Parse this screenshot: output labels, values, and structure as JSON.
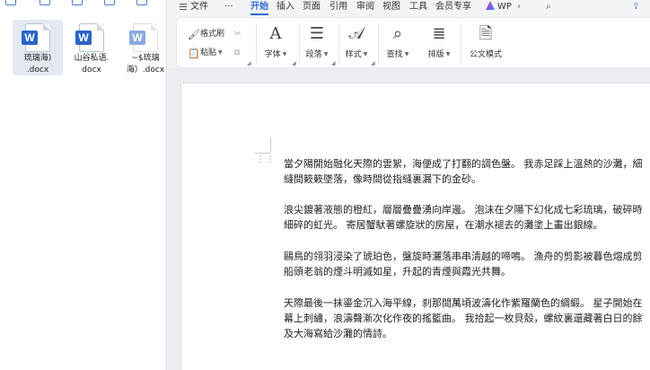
{
  "file_panel": {
    "files": [
      {
        "name_line1": "琉璃海)",
        "name_line2": ".docx"
      },
      {
        "name_line1": "山谷私语.",
        "name_line2": "docx"
      },
      {
        "name_line1": "~$琉璃",
        "name_line2": "海）.docx"
      }
    ]
  },
  "menubar": {
    "file_label": "文件",
    "more_label": "···",
    "tabs": [
      "开始",
      "插入",
      "页面",
      "引用",
      "审阅",
      "视图",
      "工具",
      "会员专享"
    ],
    "wps_label": "WP"
  },
  "ribbon": {
    "format_painter": "格式刷",
    "paste": "粘贴",
    "font": "字体",
    "paragraph": "段落",
    "style": "样式",
    "find": "查找",
    "layout": "排版",
    "official_mode": "公文模式"
  },
  "document": {
    "paragraphs": [
      {
        "line1": "當夕陽開始融化天際的雲絮，海便成了打翻的調色盤。  我赤足踩上溫熱的沙灘，細",
        "line2": "縫間簌簌墜落，像時間從指縫裏漏下的金砂。"
      },
      {
        "line1": "浪尖鍍著液態的橙紅，層層疊疊湧向岸邊。  泡沫在夕陽下幻化成七彩琉璃，破碎時",
        "line2": "細碎的虹光。  寄居蟹馱著螺旋狀的房屋，在潮水褪去的灘塗上畫出銀線。"
      },
      {
        "line1": "鷗鳥的翎羽浸染了琥珀色，盤旋時灑落串串清越的啼鳴。  漁舟的剪影被暮色熔成剪",
        "line2": "船頭老翁的煙斗明滅如星，升起的青煙與霞光共舞。"
      },
      {
        "line1": "天際最後一抹鎏金沉入海平線，刹那間萬頃波濤化作紫羅蘭色的綢緞。  星子開始在",
        "line2": "幕上刺繡，浪濤聲漸次化作夜的搖籃曲。  我拾起一枚貝殼，螺紋裏還藏著白日的餘",
        "line3": "及大海寫給沙灘的情詩。"
      }
    ]
  }
}
